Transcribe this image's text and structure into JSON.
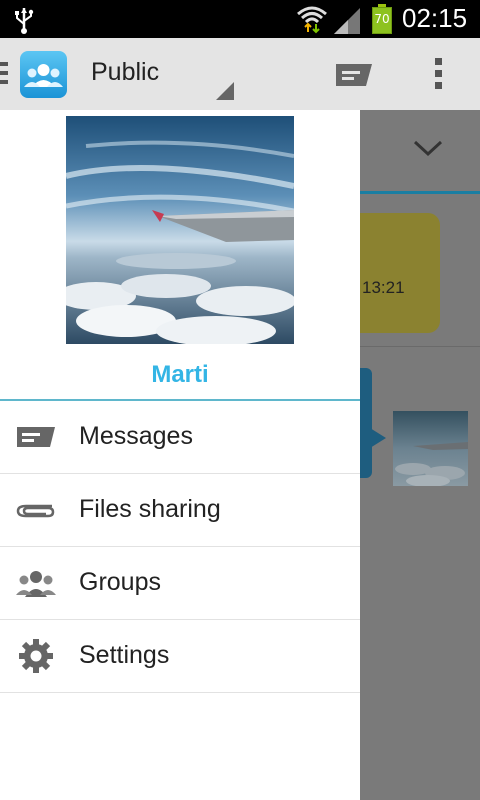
{
  "status_bar": {
    "time": "02:15",
    "battery_level": "70",
    "icons": [
      "usb-icon",
      "wifi-icon",
      "signal-icon",
      "battery-icon"
    ]
  },
  "action_bar": {
    "title": "Public",
    "icons": [
      "app-logo-icon",
      "compose-message-icon",
      "overflow-menu-icon"
    ]
  },
  "drawer": {
    "profile_name": "Marti",
    "items": [
      {
        "label": "Messages",
        "icon": "messages-icon"
      },
      {
        "label": "Files sharing",
        "icon": "paperclip-icon"
      },
      {
        "label": "Groups",
        "icon": "groups-icon"
      },
      {
        "label": "Settings",
        "icon": "gear-icon"
      }
    ]
  },
  "background": {
    "message_time": "13:21"
  },
  "colors": {
    "accent": "#33b5e5",
    "action_bar": "#e4e4e4",
    "status_bar": "#000000"
  }
}
